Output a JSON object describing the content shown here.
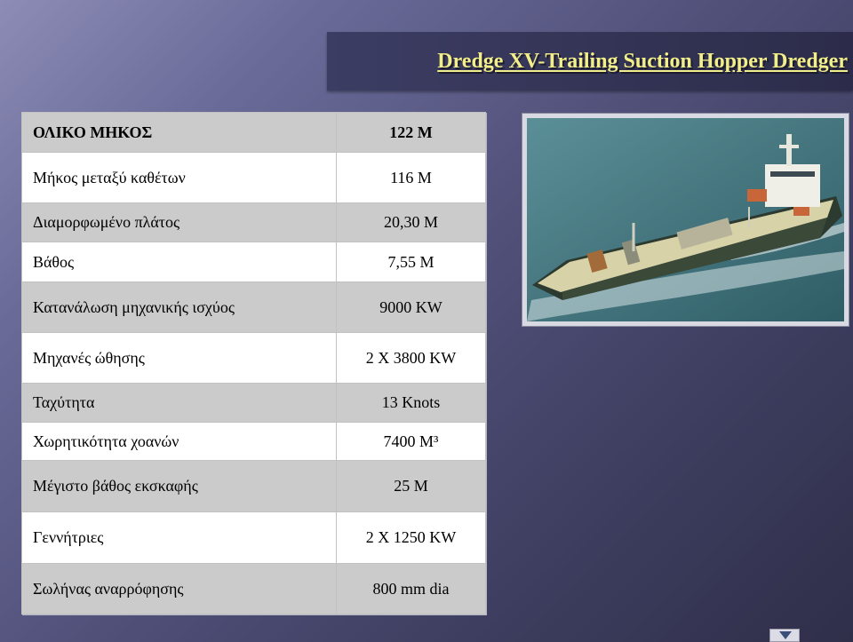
{
  "title": "Dredge XV-Trailing  Suction Hopper Dredger",
  "specs": [
    {
      "label": "ΟΛΙΚΟ ΜΗΚΟΣ",
      "value": "122 M"
    },
    {
      "label": "Μήκος μεταξύ  καθέτων",
      "value": "116 M"
    },
    {
      "label": "Διαμορφωμένο πλάτος",
      "value": "20,30 M"
    },
    {
      "label": "Βάθος",
      "value": "7,55 M"
    },
    {
      "label": "Κατανάλωση μηχανικής ισχύος",
      "value": "9000 KW"
    },
    {
      "label": "Μηχανές ώθησης",
      "value": "2 X 3800 KW"
    },
    {
      "label": "Ταχύτητα",
      "value": "13 Knots"
    },
    {
      "label": "Χωρητικότητα χοανών",
      "value": "7400 M³"
    },
    {
      "label": "Μέγιστο βάθος εκσκαφής",
      "value": "25 M"
    },
    {
      "label": "Γεννήτριες",
      "value": "2 X 1250 KW"
    },
    {
      "label": "Σωλήνας αναρρόφησης",
      "value": "800 mm dia"
    }
  ],
  "colors": {
    "title_text": "#f2ee8a",
    "title_band": "#2c2c4a",
    "row_shaded": "#cbcbcb",
    "row_plain": "#ffffff",
    "background": "#4f4f78"
  },
  "icons": {
    "photo": "ship-photo",
    "nav": "nav-down-icon"
  }
}
